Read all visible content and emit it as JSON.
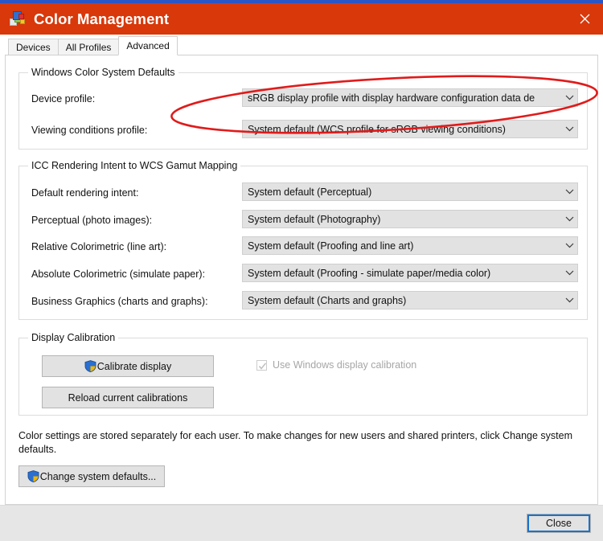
{
  "window": {
    "title": "Color Management",
    "icon": "color-management-icon",
    "close_glyph": "✕",
    "accent_color": "#2b56c6",
    "titlebar_color": "#d8380a"
  },
  "tabs": [
    {
      "label": "Devices",
      "active": false
    },
    {
      "label": "All Profiles",
      "active": false
    },
    {
      "label": "Advanced",
      "active": true
    }
  ],
  "groups": {
    "wcs_defaults": {
      "legend": "Windows Color System Defaults",
      "rows": [
        {
          "label": "Device profile:",
          "value": "sRGB display profile with display hardware configuration data de"
        },
        {
          "label": "Viewing conditions profile:",
          "value": "System default (WCS profile for sRGB viewing conditions)"
        }
      ]
    },
    "icc_mapping": {
      "legend": "ICC Rendering Intent to WCS Gamut Mapping",
      "rows": [
        {
          "label": "Default rendering intent:",
          "value": "System default (Perceptual)"
        },
        {
          "label": "Perceptual (photo images):",
          "value": "System default (Photography)"
        },
        {
          "label": "Relative Colorimetric (line art):",
          "value": "System default (Proofing and line art)"
        },
        {
          "label": "Absolute Colorimetric (simulate paper):",
          "value": "System default (Proofing - simulate paper/media color)"
        },
        {
          "label": "Business Graphics (charts and graphs):",
          "value": "System default (Charts and graphs)"
        }
      ]
    },
    "display_calibration": {
      "legend": "Display Calibration",
      "calibrate_button": "Calibrate display",
      "reload_button": "Reload current calibrations",
      "checkbox_label": "Use Windows display calibration",
      "checkbox_checked": true,
      "checkbox_disabled": true
    }
  },
  "footer": {
    "note": "Color settings are stored separately for each user. To make changes for new users and shared printers, click Change system defaults.",
    "change_defaults_button": "Change system defaults..."
  },
  "commandbar": {
    "close_label": "Close"
  },
  "annotation": {
    "type": "ellipse-highlight",
    "color": "#e01b1b",
    "target": "Device profile combo box"
  }
}
